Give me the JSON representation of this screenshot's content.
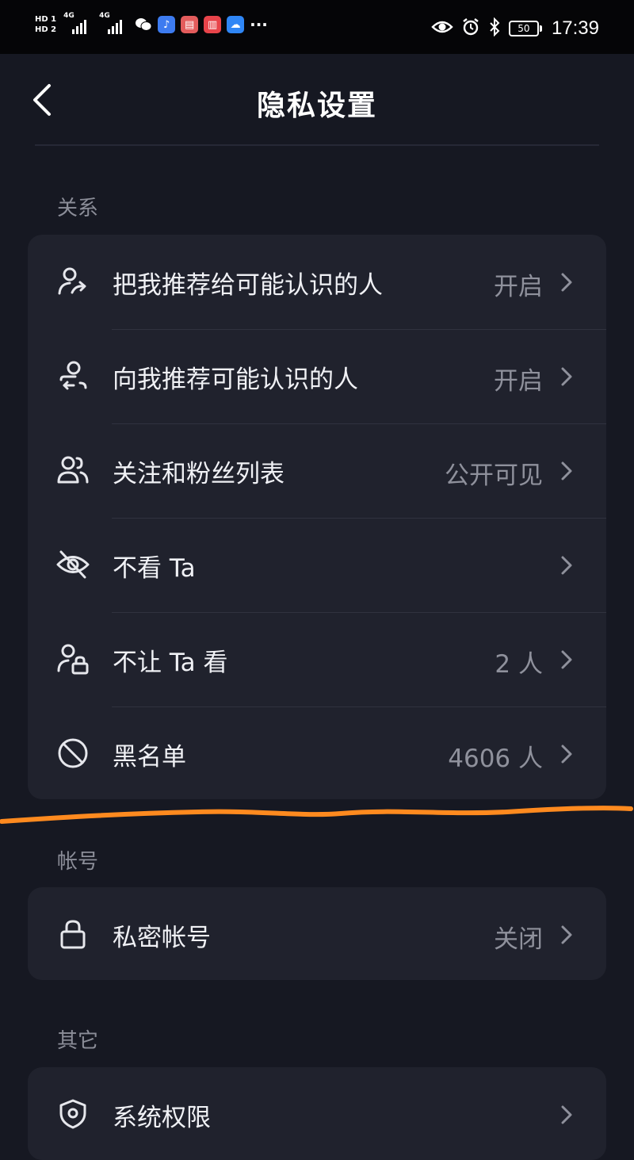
{
  "status_bar": {
    "hd1": "HD 1",
    "hd2": "HD 2",
    "net1": "4G",
    "net2": "4G",
    "more": "···",
    "battery": "50",
    "time": "17:39"
  },
  "header": {
    "title": "隐私设置"
  },
  "sections": {
    "relations": {
      "label": "关系",
      "rows": [
        {
          "label": "把我推荐给可能认识的人",
          "value": "开启",
          "icon": "person-share-icon"
        },
        {
          "label": "向我推荐可能认识的人",
          "value": "开启",
          "icon": "person-recommend-icon"
        },
        {
          "label": "关注和粉丝列表",
          "value": "公开可见",
          "icon": "people-icon"
        },
        {
          "label": "不看 Ta",
          "value": "",
          "icon": "eye-off-icon"
        },
        {
          "label": "不让 Ta 看",
          "value": "2 人",
          "icon": "person-lock-icon"
        },
        {
          "label": "黑名单",
          "value": "4606 人",
          "icon": "block-icon"
        }
      ]
    },
    "account": {
      "label": "帐号",
      "rows": [
        {
          "label": "私密帐号",
          "value": "关闭",
          "icon": "lock-icon"
        }
      ]
    },
    "other": {
      "label": "其它",
      "rows": [
        {
          "label": "系统权限",
          "value": "",
          "icon": "shield-icon"
        }
      ]
    }
  },
  "colors": {
    "background": "#161822",
    "card": "#20222d",
    "annotation": "#ff8a1f"
  }
}
